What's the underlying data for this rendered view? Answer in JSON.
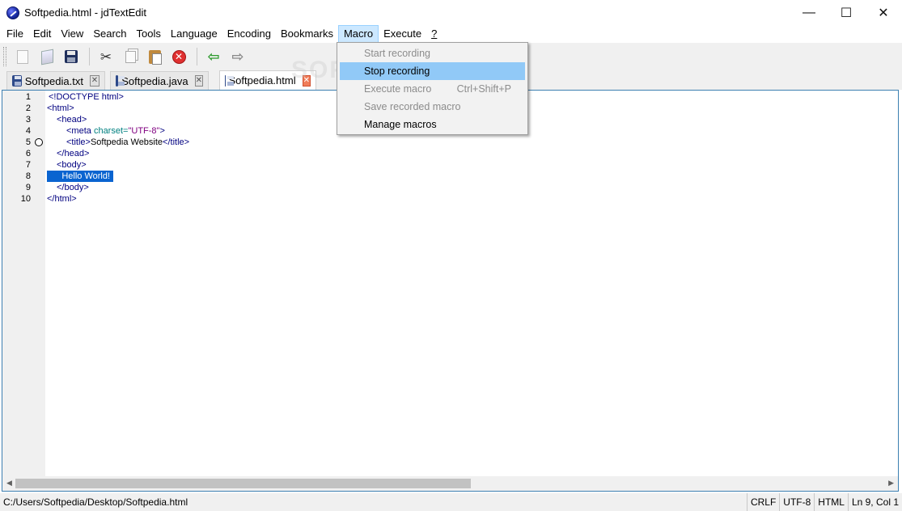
{
  "window": {
    "title": "Softpedia.html - jdTextEdit",
    "minimize": "—",
    "maximize": "☐",
    "close": "✕"
  },
  "menubar": {
    "items": [
      {
        "name": "file",
        "label": "File"
      },
      {
        "name": "edit",
        "label": "Edit"
      },
      {
        "name": "view",
        "label": "View"
      },
      {
        "name": "search",
        "label": "Search"
      },
      {
        "name": "tools",
        "label": "Tools"
      },
      {
        "name": "language",
        "label": "Language"
      },
      {
        "name": "encoding",
        "label": "Encoding"
      },
      {
        "name": "bookmarks",
        "label": "Bookmarks"
      },
      {
        "name": "macro",
        "label": "Macro"
      },
      {
        "name": "execute",
        "label": "Execute"
      },
      {
        "name": "help",
        "label": "?"
      }
    ]
  },
  "toolbar": {
    "icons": [
      "new-file-icon",
      "open-file-icon",
      "save-icon",
      "cut-icon",
      "copy-icon",
      "paste-icon",
      "close-file-icon",
      "undo-icon",
      "redo-icon"
    ]
  },
  "tabs": [
    {
      "label": "Softpedia.txt",
      "active": false
    },
    {
      "label": "Softpedia.java",
      "active": false
    },
    {
      "label": "Softpedia.html",
      "active": true
    }
  ],
  "editor": {
    "line_numbers": [
      "1",
      "2",
      "3",
      "4",
      "5",
      "6",
      "7",
      "8",
      "9",
      "10"
    ],
    "lines": {
      "l1_open": "<!DOCTYPE",
      "l1_attr": " html",
      "l1_close": ">",
      "l2": "<html>",
      "l3": "<head>",
      "l4_open": "<meta",
      "l4_attr": " charset",
      "l4_eq": "=",
      "l4_str": "\"UTF-8\"",
      "l4_close": ">",
      "l5_open": "<title>",
      "l5_text": "Softpedia Website",
      "l5_close": "</title>",
      "l6": "</head>",
      "l7": "<body>",
      "l8": "      Hello World!",
      "l9": "</body>",
      "l10": "</html>"
    },
    "selected_line": 8,
    "bookmark_line": 5
  },
  "macro_menu": {
    "items": [
      {
        "label": "Start recording",
        "enabled": false,
        "shortcut": ""
      },
      {
        "label": "Stop recording",
        "enabled": true,
        "shortcut": ""
      },
      {
        "label": "Execute macro",
        "enabled": false,
        "shortcut": "Ctrl+Shift+P"
      },
      {
        "label": "Save recorded macro",
        "enabled": false,
        "shortcut": ""
      },
      {
        "label": "Manage macros",
        "enabled": true,
        "shortcut": ""
      }
    ]
  },
  "statusbar": {
    "path": "C:/Users/Softpedia/Desktop/Softpedia.html",
    "line_ending": "CRLF",
    "encoding": "UTF-8",
    "language": "HTML",
    "position": "Ln 9, Col 1"
  },
  "watermark": "SOFTPEDIA",
  "colors": {
    "accent": "#3c7fb1",
    "selection": "#0a64d0",
    "menu_hover": "#91c9f7",
    "tag": "#000080",
    "attribute": "#008080",
    "string": "#800080"
  }
}
